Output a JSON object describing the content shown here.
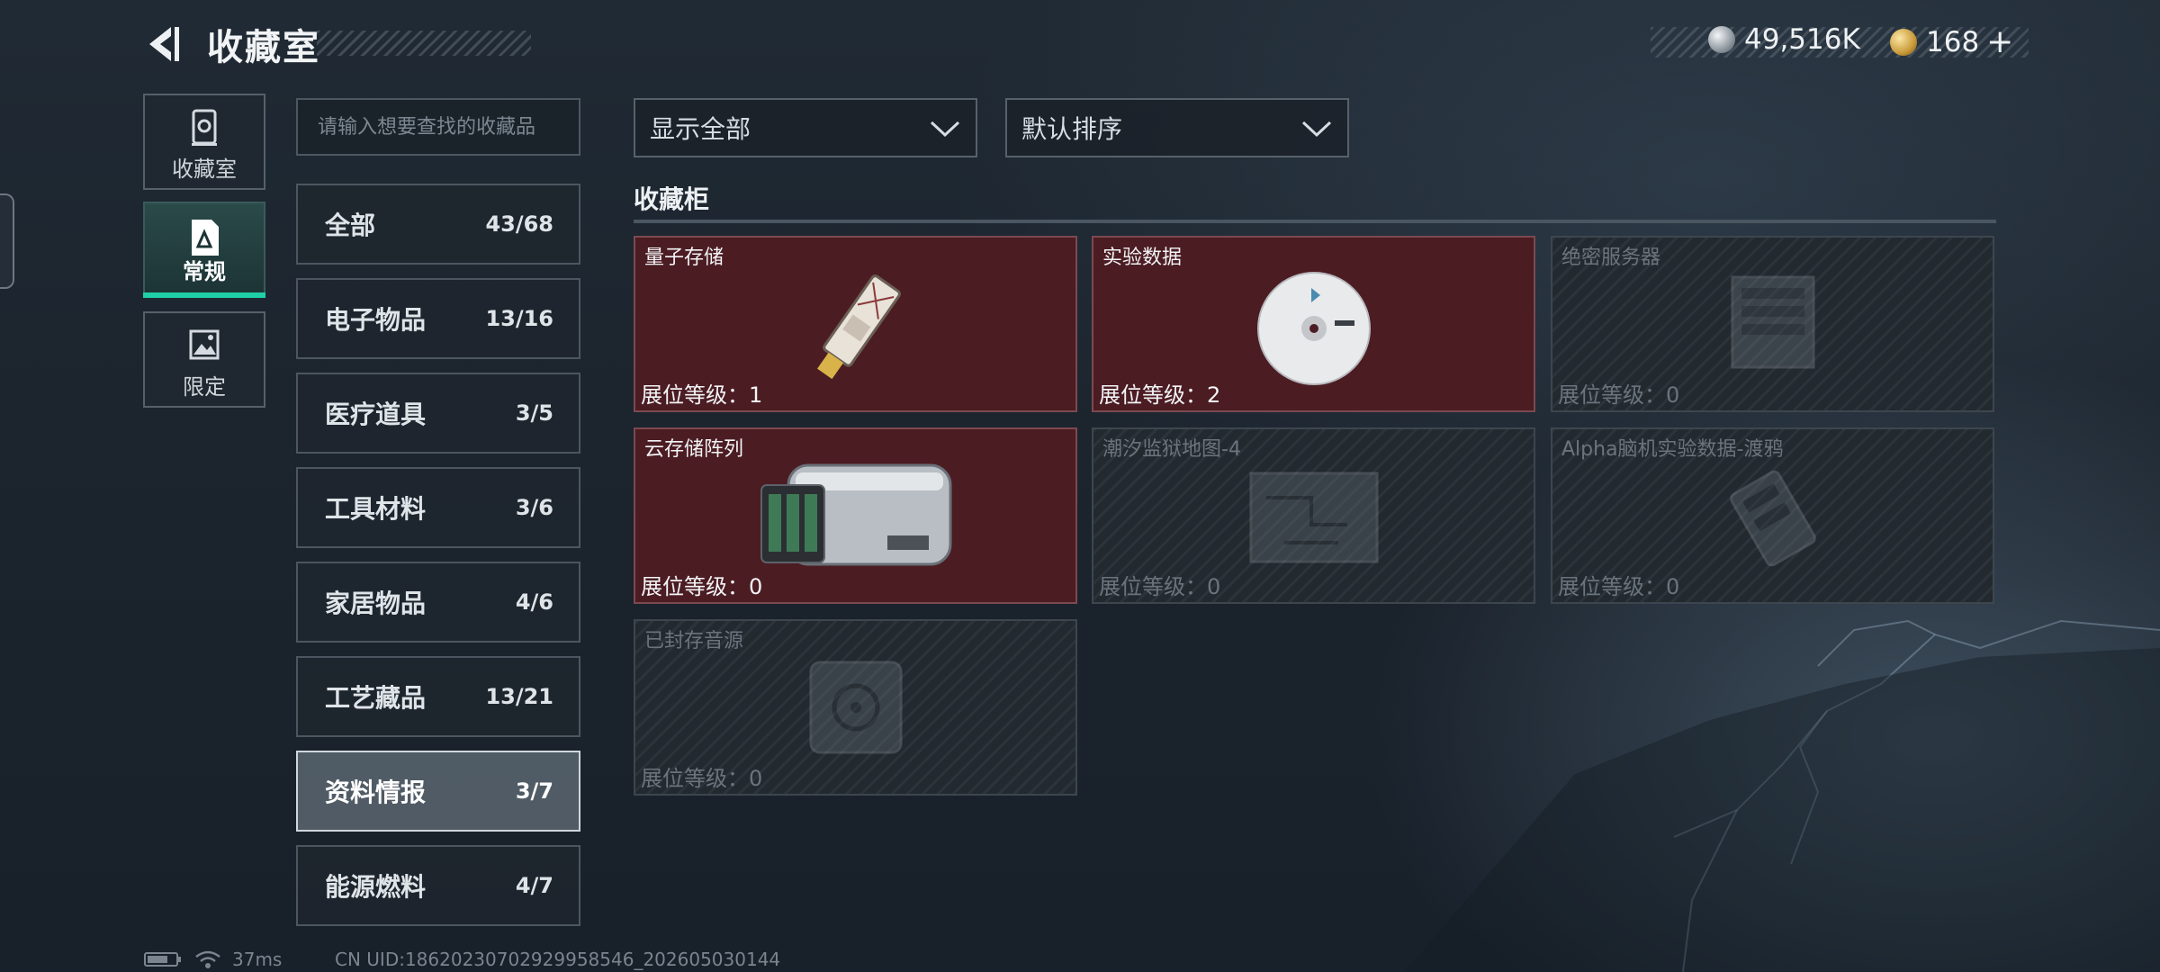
{
  "header": {
    "title": "收藏室",
    "back_icon": "back-arrow-icon",
    "currencies": [
      {
        "icon": "silver-coin-icon",
        "value": "49,516K"
      },
      {
        "icon": "gold-coin-icon",
        "value": "168"
      }
    ],
    "add_symbol": "+"
  },
  "side_nav": [
    {
      "label": "收藏室",
      "icon": "vault-icon"
    },
    {
      "label": "常规",
      "icon": "document-icon",
      "active": true
    },
    {
      "label": "限定",
      "icon": "image-icon"
    }
  ],
  "search": {
    "placeholder": "请输入想要查找的收藏品"
  },
  "categories": [
    {
      "name": "全部",
      "count": "43/68"
    },
    {
      "name": "电子物品",
      "count": "13/16"
    },
    {
      "name": "医疗道具",
      "count": "3/5"
    },
    {
      "name": "工具材料",
      "count": "3/6"
    },
    {
      "name": "家居物品",
      "count": "4/6"
    },
    {
      "name": "工艺藏品",
      "count": "13/21"
    },
    {
      "name": "资料情报",
      "count": "3/7",
      "active": true
    },
    {
      "name": "能源燃料",
      "count": "4/7"
    }
  ],
  "filters": {
    "display": "显示全部",
    "sort": "默认排序"
  },
  "section_title": "收藏柜",
  "items": [
    {
      "name": "量子存储",
      "level": "展位等级：1",
      "owned": true
    },
    {
      "name": "实验数据",
      "level": "展位等级：2",
      "owned": true
    },
    {
      "name": "绝密服务器",
      "level": "展位等级：0",
      "owned": false
    },
    {
      "name": "云存储阵列",
      "level": "展位等级：0",
      "owned": true
    },
    {
      "name": "潮汐监狱地图-4",
      "level": "展位等级：0",
      "owned": false
    },
    {
      "name": "Alpha脑机实验数据-渡鸦",
      "level": "展位等级：0",
      "owned": false
    },
    {
      "name": "已封存音源",
      "level": "展位等级：0",
      "owned": false
    }
  ],
  "status_bar": {
    "ping": "37ms",
    "uid": "CN UID:1862023070292995854​6_202605030144"
  },
  "colors": {
    "accent": "#1fcfa8",
    "owned_card": "#4c1c23",
    "locked_card": "#222a30"
  }
}
